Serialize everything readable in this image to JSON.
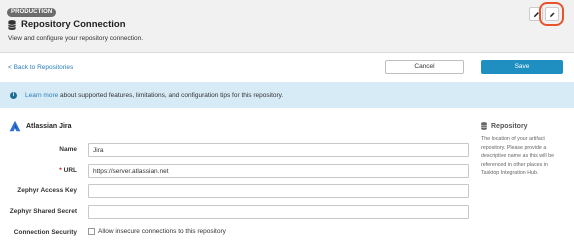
{
  "header": {
    "environment_badge": "PRODUCTION",
    "title": "Repository Connection",
    "subtitle": "View and configure your repository connection.",
    "icons": [
      "database-icon",
      "edit-icon",
      "settings-icon"
    ]
  },
  "toolbar": {
    "back_link": "< Back to Repositories",
    "cancel_label": "Cancel",
    "save_label": "Save"
  },
  "info_banner": {
    "icon": "info-icon",
    "prefix": "Learn more",
    "text": " about supported features, limitations, and configuration tips for this repository."
  },
  "repository": {
    "name": "Atlassian Jira",
    "logo": "jira-logo"
  },
  "form": {
    "name_label": "Name",
    "name_value": "Jira",
    "url_required_mark": "*",
    "url_label": "URL",
    "url_value": "https://server.atlassian.net",
    "access_key_label": "Zephyr Access Key",
    "access_key_value": "",
    "shared_secret_label": "Zephyr Shared Secret",
    "shared_secret_value": "",
    "security_label": "Connection Security",
    "security_checkbox_label": "Allow insecure connections to this repository",
    "security_checked": false
  },
  "side_panel": {
    "title": "Repository",
    "line1": "The location of your artifact",
    "line2": "repository. Please provide a",
    "line3": "descriptive name as this will be",
    "line4": "referenced in other places in",
    "line5": "Tasktop Integration Hub."
  },
  "colors": {
    "accent": "#1f8fc2",
    "link": "#2a7fbf",
    "info_bg": "#d7ebf6",
    "highlight": "#e8532c",
    "jira_blue": "#2f6fd6"
  }
}
